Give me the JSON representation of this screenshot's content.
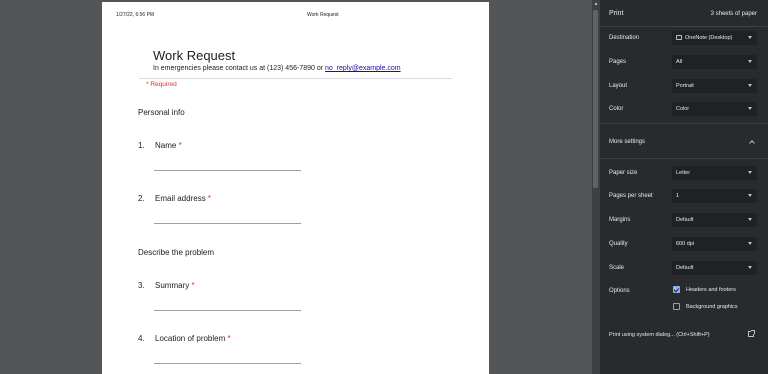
{
  "page": {
    "timestamp": "1/27/22, 6:56 PM",
    "doc_title": "Work Request"
  },
  "form": {
    "title": "Work Request",
    "desc_prefix": "In emergencies please contact us at (123) 456-7890 or ",
    "email": "no_reply@example.com",
    "required": "* Required",
    "sections": {
      "personal": "Personal info",
      "problem": "Describe the problem"
    },
    "questions": [
      {
        "num": "1.",
        "label": "Name",
        "star": "*"
      },
      {
        "num": "2.",
        "label": "Email address",
        "star": "*"
      },
      {
        "num": "3.",
        "label": "Summary",
        "star": "*"
      },
      {
        "num": "4.",
        "label": "Location of problem",
        "star": "*"
      }
    ]
  },
  "sidebar": {
    "title": "Print",
    "sheets": "3 sheets of paper",
    "destination": {
      "label": "Destination",
      "value": "OneNote (Desktop)"
    },
    "pages": {
      "label": "Pages",
      "value": "All"
    },
    "layout": {
      "label": "Layout",
      "value": "Portrait"
    },
    "color": {
      "label": "Color",
      "value": "Color"
    },
    "more_settings": "More settings",
    "paper_size": {
      "label": "Paper size",
      "value": "Letter"
    },
    "pages_per_sheet": {
      "label": "Pages per sheet",
      "value": "1"
    },
    "margins": {
      "label": "Margins",
      "value": "Default"
    },
    "quality": {
      "label": "Quality",
      "value": "600 dpi"
    },
    "scale": {
      "label": "Scale",
      "value": "Default"
    },
    "options": {
      "label": "Options",
      "headers_footers": {
        "label": "Headers and footers",
        "checked": true
      },
      "background_graphics": {
        "label": "Background graphics",
        "checked": false
      }
    },
    "system_dialog": "Print using system dialog... (Ctrl+Shift+P)"
  },
  "colors": {
    "sidebar_bg": "#292a2d",
    "preview_bg": "#525659",
    "required_red": "#d93025",
    "checkbox_blue": "#8ab4f8"
  }
}
